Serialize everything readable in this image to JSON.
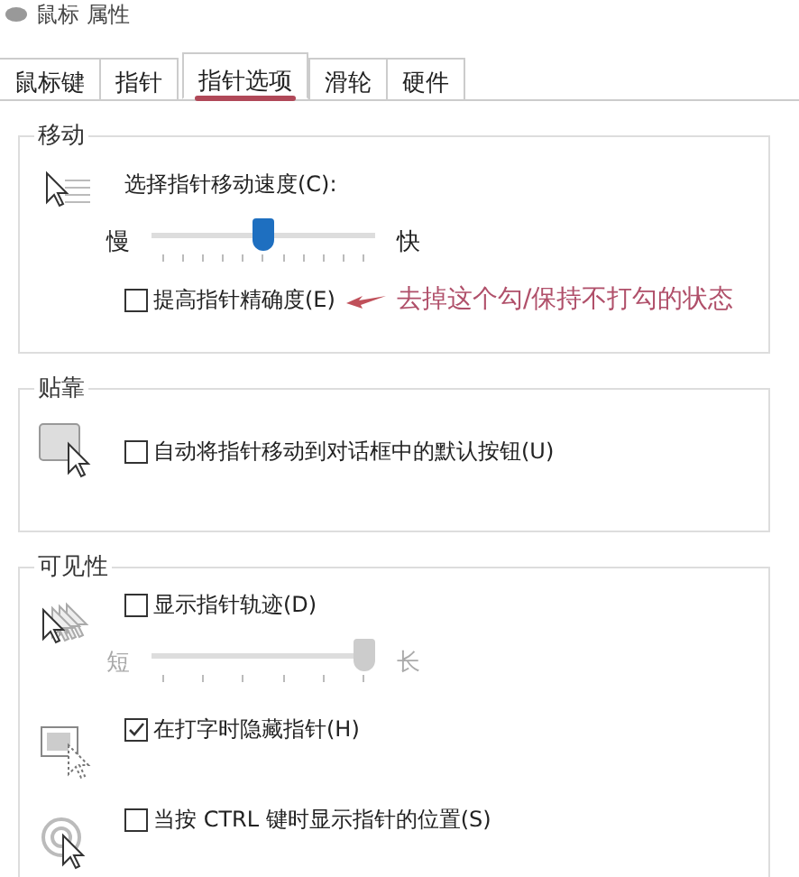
{
  "window": {
    "title": "鼠标 属性"
  },
  "tabs": [
    {
      "label": "鼠标键",
      "selected": false
    },
    {
      "label": "指针",
      "selected": false
    },
    {
      "label": "指针选项",
      "selected": true
    },
    {
      "label": "滑轮",
      "selected": false
    },
    {
      "label": "硬件",
      "selected": false
    }
  ],
  "groups": [
    {
      "title": "移动",
      "blocks": [
        {
          "rows": [
            {
              "kind": "label",
              "text": "选择指针移动速度(C):"
            },
            {
              "kind": "slider",
              "min_label": "慢",
              "max_label": "快",
              "level": 0.5,
              "disabled": false
            },
            {
              "kind": "checkbox",
              "label": "提高指针精确度(E)",
              "checked": false,
              "annotation": "去掉这个勾/保持不打勾的状态"
            }
          ]
        }
      ]
    },
    {
      "title": "贴靠",
      "blocks": [
        {
          "rows": [
            {
              "kind": "checkbox",
              "label": "自动将指针移动到对话框中的默认按钮(U)",
              "checked": false
            }
          ]
        }
      ]
    },
    {
      "title": "可见性",
      "blocks": [
        {
          "rows": [
            {
              "kind": "checkbox",
              "label": "显示指针轨迹(D)",
              "checked": false
            },
            {
              "kind": "slider",
              "min_label": "短",
              "max_label": "长",
              "level": 1,
              "disabled": true
            }
          ]
        },
        {
          "rows": [
            {
              "kind": "checkbox",
              "label": "在打字时隐藏指针(H)",
              "checked": true
            }
          ]
        },
        {
          "rows": [
            {
              "kind": "checkbox",
              "label": "当按 CTRL 键时显示指针的位置(S)",
              "checked": false
            }
          ]
        }
      ]
    }
  ]
}
